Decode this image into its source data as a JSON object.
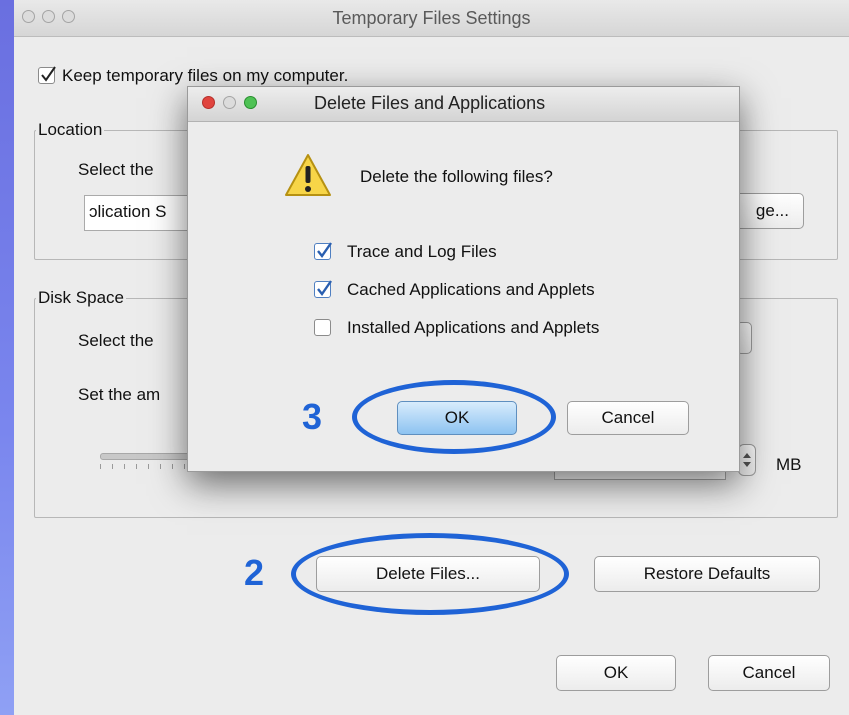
{
  "main_window": {
    "title": "Temporary Files Settings",
    "keep_temp_label": "Keep temporary files on my computer.",
    "keep_temp_checked": true,
    "location": {
      "legend": "Location",
      "select_text": "Select the",
      "path_value": "ɔlication S",
      "change_label": "ge..."
    },
    "disk_space": {
      "legend": "Disk Space",
      "select_text": "Select the",
      "set_text": "Set the am",
      "unit": "MB"
    },
    "delete_files_label": "Delete Files...",
    "restore_defaults_label": "Restore Defaults",
    "ok_label": "OK",
    "cancel_label": "Cancel"
  },
  "dialog": {
    "title": "Delete Files and Applications",
    "prompt": "Delete the following files?",
    "options": [
      {
        "label": "Trace and Log Files",
        "checked": true
      },
      {
        "label": "Cached Applications and Applets",
        "checked": true
      },
      {
        "label": "Installed Applications and Applets",
        "checked": false
      }
    ],
    "ok_label": "OK",
    "cancel_label": "Cancel"
  },
  "annotations": {
    "step2": "2",
    "step3": "3",
    "color": "#1f63d6"
  },
  "colors": {
    "close": "#e0443e",
    "minimize": "#dea123",
    "zoom": "#1aab29",
    "check": "#2a5fb0"
  }
}
